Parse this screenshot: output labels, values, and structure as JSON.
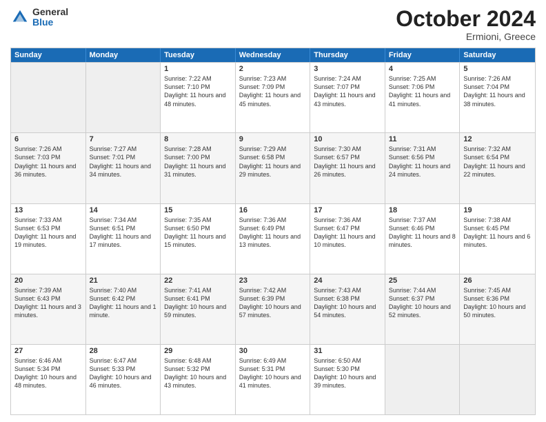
{
  "header": {
    "logo_general": "General",
    "logo_blue": "Blue",
    "month_title": "October 2024",
    "location": "Ermioni, Greece"
  },
  "days_of_week": [
    "Sunday",
    "Monday",
    "Tuesday",
    "Wednesday",
    "Thursday",
    "Friday",
    "Saturday"
  ],
  "rows": [
    [
      {
        "day": "",
        "empty": true
      },
      {
        "day": "",
        "empty": true
      },
      {
        "day": "1",
        "sunrise": "Sunrise: 7:22 AM",
        "sunset": "Sunset: 7:10 PM",
        "daylight": "Daylight: 11 hours and 48 minutes."
      },
      {
        "day": "2",
        "sunrise": "Sunrise: 7:23 AM",
        "sunset": "Sunset: 7:09 PM",
        "daylight": "Daylight: 11 hours and 45 minutes."
      },
      {
        "day": "3",
        "sunrise": "Sunrise: 7:24 AM",
        "sunset": "Sunset: 7:07 PM",
        "daylight": "Daylight: 11 hours and 43 minutes."
      },
      {
        "day": "4",
        "sunrise": "Sunrise: 7:25 AM",
        "sunset": "Sunset: 7:06 PM",
        "daylight": "Daylight: 11 hours and 41 minutes."
      },
      {
        "day": "5",
        "sunrise": "Sunrise: 7:26 AM",
        "sunset": "Sunset: 7:04 PM",
        "daylight": "Daylight: 11 hours and 38 minutes."
      }
    ],
    [
      {
        "day": "6",
        "sunrise": "Sunrise: 7:26 AM",
        "sunset": "Sunset: 7:03 PM",
        "daylight": "Daylight: 11 hours and 36 minutes."
      },
      {
        "day": "7",
        "sunrise": "Sunrise: 7:27 AM",
        "sunset": "Sunset: 7:01 PM",
        "daylight": "Daylight: 11 hours and 34 minutes."
      },
      {
        "day": "8",
        "sunrise": "Sunrise: 7:28 AM",
        "sunset": "Sunset: 7:00 PM",
        "daylight": "Daylight: 11 hours and 31 minutes."
      },
      {
        "day": "9",
        "sunrise": "Sunrise: 7:29 AM",
        "sunset": "Sunset: 6:58 PM",
        "daylight": "Daylight: 11 hours and 29 minutes."
      },
      {
        "day": "10",
        "sunrise": "Sunrise: 7:30 AM",
        "sunset": "Sunset: 6:57 PM",
        "daylight": "Daylight: 11 hours and 26 minutes."
      },
      {
        "day": "11",
        "sunrise": "Sunrise: 7:31 AM",
        "sunset": "Sunset: 6:56 PM",
        "daylight": "Daylight: 11 hours and 24 minutes."
      },
      {
        "day": "12",
        "sunrise": "Sunrise: 7:32 AM",
        "sunset": "Sunset: 6:54 PM",
        "daylight": "Daylight: 11 hours and 22 minutes."
      }
    ],
    [
      {
        "day": "13",
        "sunrise": "Sunrise: 7:33 AM",
        "sunset": "Sunset: 6:53 PM",
        "daylight": "Daylight: 11 hours and 19 minutes."
      },
      {
        "day": "14",
        "sunrise": "Sunrise: 7:34 AM",
        "sunset": "Sunset: 6:51 PM",
        "daylight": "Daylight: 11 hours and 17 minutes."
      },
      {
        "day": "15",
        "sunrise": "Sunrise: 7:35 AM",
        "sunset": "Sunset: 6:50 PM",
        "daylight": "Daylight: 11 hours and 15 minutes."
      },
      {
        "day": "16",
        "sunrise": "Sunrise: 7:36 AM",
        "sunset": "Sunset: 6:49 PM",
        "daylight": "Daylight: 11 hours and 13 minutes."
      },
      {
        "day": "17",
        "sunrise": "Sunrise: 7:36 AM",
        "sunset": "Sunset: 6:47 PM",
        "daylight": "Daylight: 11 hours and 10 minutes."
      },
      {
        "day": "18",
        "sunrise": "Sunrise: 7:37 AM",
        "sunset": "Sunset: 6:46 PM",
        "daylight": "Daylight: 11 hours and 8 minutes."
      },
      {
        "day": "19",
        "sunrise": "Sunrise: 7:38 AM",
        "sunset": "Sunset: 6:45 PM",
        "daylight": "Daylight: 11 hours and 6 minutes."
      }
    ],
    [
      {
        "day": "20",
        "sunrise": "Sunrise: 7:39 AM",
        "sunset": "Sunset: 6:43 PM",
        "daylight": "Daylight: 11 hours and 3 minutes."
      },
      {
        "day": "21",
        "sunrise": "Sunrise: 7:40 AM",
        "sunset": "Sunset: 6:42 PM",
        "daylight": "Daylight: 11 hours and 1 minute."
      },
      {
        "day": "22",
        "sunrise": "Sunrise: 7:41 AM",
        "sunset": "Sunset: 6:41 PM",
        "daylight": "Daylight: 10 hours and 59 minutes."
      },
      {
        "day": "23",
        "sunrise": "Sunrise: 7:42 AM",
        "sunset": "Sunset: 6:39 PM",
        "daylight": "Daylight: 10 hours and 57 minutes."
      },
      {
        "day": "24",
        "sunrise": "Sunrise: 7:43 AM",
        "sunset": "Sunset: 6:38 PM",
        "daylight": "Daylight: 10 hours and 54 minutes."
      },
      {
        "day": "25",
        "sunrise": "Sunrise: 7:44 AM",
        "sunset": "Sunset: 6:37 PM",
        "daylight": "Daylight: 10 hours and 52 minutes."
      },
      {
        "day": "26",
        "sunrise": "Sunrise: 7:45 AM",
        "sunset": "Sunset: 6:36 PM",
        "daylight": "Daylight: 10 hours and 50 minutes."
      }
    ],
    [
      {
        "day": "27",
        "sunrise": "Sunrise: 6:46 AM",
        "sunset": "Sunset: 5:34 PM",
        "daylight": "Daylight: 10 hours and 48 minutes."
      },
      {
        "day": "28",
        "sunrise": "Sunrise: 6:47 AM",
        "sunset": "Sunset: 5:33 PM",
        "daylight": "Daylight: 10 hours and 46 minutes."
      },
      {
        "day": "29",
        "sunrise": "Sunrise: 6:48 AM",
        "sunset": "Sunset: 5:32 PM",
        "daylight": "Daylight: 10 hours and 43 minutes."
      },
      {
        "day": "30",
        "sunrise": "Sunrise: 6:49 AM",
        "sunset": "Sunset: 5:31 PM",
        "daylight": "Daylight: 10 hours and 41 minutes."
      },
      {
        "day": "31",
        "sunrise": "Sunrise: 6:50 AM",
        "sunset": "Sunset: 5:30 PM",
        "daylight": "Daylight: 10 hours and 39 minutes."
      },
      {
        "day": "",
        "empty": true
      },
      {
        "day": "",
        "empty": true
      }
    ]
  ]
}
